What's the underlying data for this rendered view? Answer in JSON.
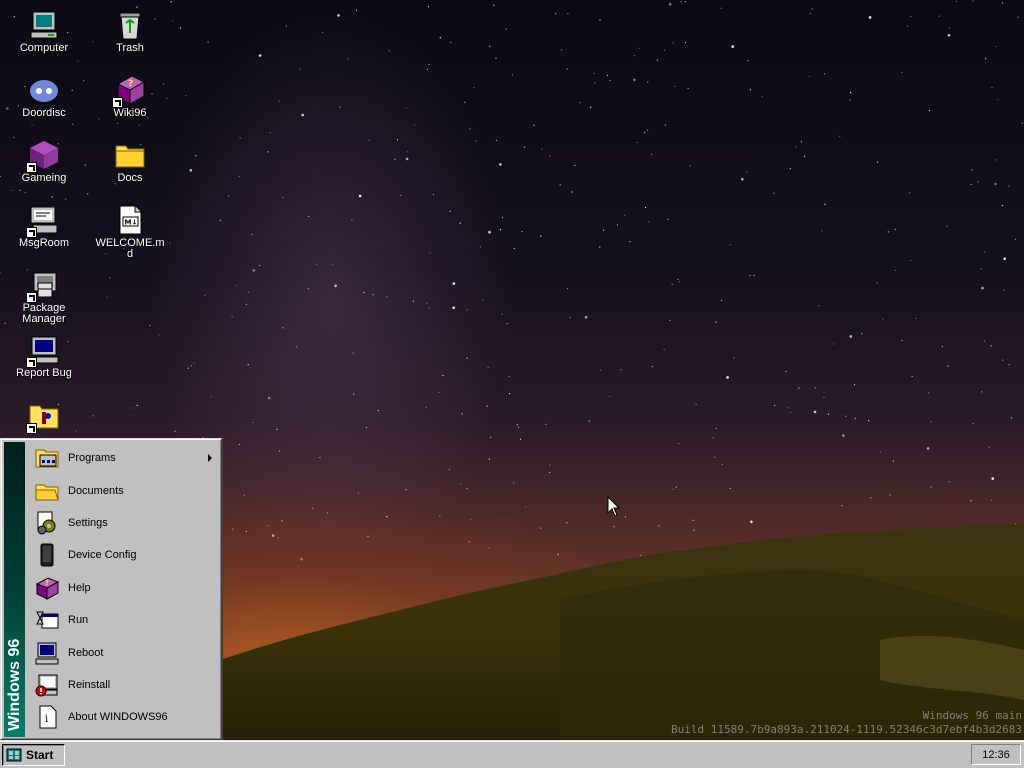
{
  "desktop": {
    "icons": [
      {
        "label": "Computer",
        "icon": "computer-icon"
      },
      {
        "label": "Trash",
        "icon": "trash-icon"
      },
      {
        "label": "Doordisc",
        "icon": "discord-icon"
      },
      {
        "label": "Wiki96",
        "icon": "help-book-icon"
      },
      {
        "label": "Gameing",
        "icon": "game-cube-icon"
      },
      {
        "label": "Docs",
        "icon": "folder-icon"
      },
      {
        "label": "MsgRoom",
        "icon": "chat-computer-icon"
      },
      {
        "label": "WELCOME.md",
        "icon": "markdown-file-icon"
      },
      {
        "label": "Package Manager",
        "icon": "package-manager-icon"
      },
      {
        "label": "Report Bug",
        "icon": "report-bug-icon"
      },
      {
        "label": "",
        "icon": "utility-folder-icon"
      }
    ]
  },
  "watermark": {
    "line1": "Windows 96 main",
    "line2": "Build 11589.7b9a893a.211024-1119.52346c3d7ebf4b3d2683"
  },
  "start_menu": {
    "banner": "Windows 96",
    "items": [
      {
        "label": "Programs",
        "icon": "programs-icon",
        "submenu": true
      },
      {
        "label": "Documents",
        "icon": "documents-icon"
      },
      {
        "label": "Settings",
        "icon": "settings-icon"
      },
      {
        "label": "Device Config",
        "icon": "device-config-icon"
      },
      {
        "label": "Help",
        "icon": "help-icon"
      },
      {
        "label": "Run",
        "icon": "run-icon"
      },
      {
        "label": "Reboot",
        "icon": "reboot-icon"
      },
      {
        "label": "Reinstall",
        "icon": "reinstall-icon"
      },
      {
        "label": "About WINDOWS96",
        "icon": "about-icon"
      }
    ]
  },
  "taskbar": {
    "start_label": "Start",
    "clock": "12:36"
  },
  "colors": {
    "face": "#c0c0c0",
    "banner": "#003f33",
    "highlight": "#000080"
  }
}
